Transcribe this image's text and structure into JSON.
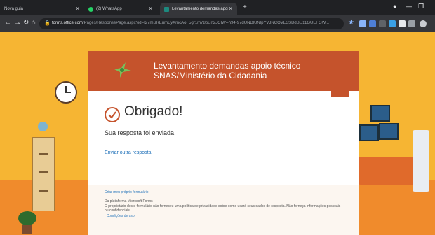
{
  "browser": {
    "tabs": [
      {
        "label": "Nova guia",
        "active": false
      },
      {
        "label": "(2) WhatsApp",
        "active": false
      },
      {
        "label": "Levantamento demandas apoio t",
        "active": true
      }
    ],
    "address": {
      "domain": "forms.office.com",
      "path": "/Pages/ResponsePage.aspx?id=I27mSREumEyXmcAoF5gr1m78oUn2JCIW--h94-97dUNDlUNlpYVJNCOVE3SDdBU11GUEFGW..."
    },
    "colors": {
      "chrome_dark": "#202124",
      "chrome_mid": "#35363a"
    }
  },
  "form": {
    "header_title": "Levantamento demandas apoio técnico\nSNAS/Ministério da Cidadania",
    "more_label": "...",
    "thanks": "Obrigado!",
    "submitted": "Sua resposta foi enviada.",
    "another_response": "Enviar outra resposta",
    "footer": {
      "create_own": "Criar meu próprio formulário",
      "platform": "Da plataforma Microsoft Forms |",
      "disclaimer": "O proprietário deste formulário não forneceu uma política de privacidade sobre como usará seus dados de resposta. Não forneça informações pessoais ou confidenciais.",
      "terms": "| Condições de uso"
    },
    "colors": {
      "accent": "#c5532c",
      "link": "#1d6fb8"
    }
  },
  "icons": [
    "back-icon",
    "forward-icon",
    "reload-icon",
    "home-icon",
    "lock-icon",
    "star-icon",
    "whatsapp-icon",
    "forms-icon",
    "check-circle-icon",
    "hummingbird-logo"
  ]
}
